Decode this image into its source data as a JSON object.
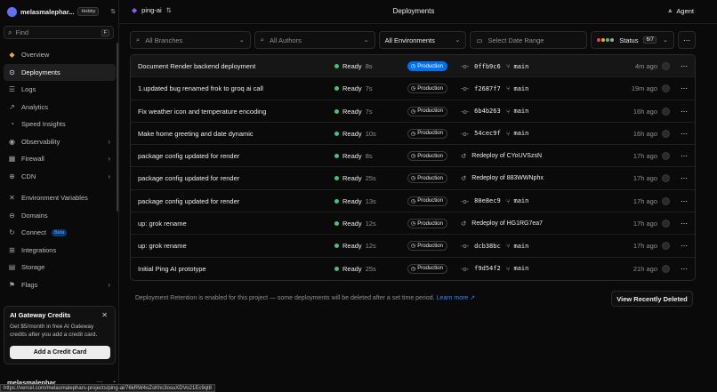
{
  "sidebar": {
    "team_name": "melasmalephar...",
    "plan_badge": "Hobby",
    "find_placeholder": "Find",
    "find_shortcut": "F",
    "items": [
      {
        "label": "Overview",
        "icon": "overview-icon"
      },
      {
        "label": "Deployments",
        "icon": "deployments-icon"
      },
      {
        "label": "Logs",
        "icon": "logs-icon"
      },
      {
        "label": "Analytics",
        "icon": "analytics-icon"
      },
      {
        "label": "Speed Insights",
        "icon": "speed-insights-icon"
      },
      {
        "label": "Observability",
        "icon": "observability-icon"
      },
      {
        "label": "Firewall",
        "icon": "firewall-icon"
      },
      {
        "label": "CDN",
        "icon": "cdn-icon"
      },
      {
        "label": "Environment Variables",
        "icon": "env-vars-icon"
      },
      {
        "label": "Domains",
        "icon": "domains-icon"
      },
      {
        "label": "Connect",
        "icon": "connect-icon",
        "badge": "Beta"
      },
      {
        "label": "Integrations",
        "icon": "integrations-icon"
      },
      {
        "label": "Storage",
        "icon": "storage-icon"
      },
      {
        "label": "Flags",
        "icon": "flags-icon"
      }
    ],
    "promo": {
      "title": "AI Gateway Credits",
      "text": "Get $5/month in free AI Gateway credits after you add a credit card.",
      "button": "Add a Credit Card"
    },
    "user_name": "melasmalephar"
  },
  "status_url": "https://vercel.com/melasmalephars-projects/ping-ai/76kRW4oZsKhc3osuXDVo21Ec9qt8",
  "topbar": {
    "project_name": "ping-ai",
    "title": "Deployments",
    "agent_label": "Agent"
  },
  "filters": {
    "branches_placeholder": "All Branches",
    "authors_placeholder": "All Authors",
    "environments_value": "All Environments",
    "date_placeholder": "Select Date Range",
    "status_label": "Status",
    "status_count": "6/7",
    "status_colors": [
      "#e5484d",
      "#f5a623",
      "#45c27a",
      "#a1a1a1"
    ]
  },
  "deployments": [
    {
      "title": "Document Render backend deployment",
      "status": "Ready",
      "duration": "8s",
      "env": "Production",
      "current": true,
      "commit": "0ffb9c6",
      "redeploy": false,
      "branch": "main",
      "time": "4m ago"
    },
    {
      "title": "1.updated bug renamed frok to groq ai call",
      "status": "Ready",
      "duration": "7s",
      "env": "Production",
      "current": false,
      "commit": "f2687f7",
      "redeploy": false,
      "branch": "main",
      "time": "19m ago"
    },
    {
      "title": "Fix weather icon and temperature encoding",
      "status": "Ready",
      "duration": "7s",
      "env": "Production",
      "current": false,
      "commit": "6b4b263",
      "redeploy": false,
      "branch": "main",
      "time": "16h ago"
    },
    {
      "title": "Make home greeting and date dynamic",
      "status": "Ready",
      "duration": "10s",
      "env": "Production",
      "current": false,
      "commit": "54cec9f",
      "redeploy": false,
      "branch": "main",
      "time": "16h ago"
    },
    {
      "title": "package config updated for render",
      "status": "Ready",
      "duration": "8s",
      "env": "Production",
      "current": false,
      "commit": "Redeploy of CYoUVSzsN",
      "redeploy": true,
      "branch": "",
      "time": "17h ago"
    },
    {
      "title": "package config updated for render",
      "status": "Ready",
      "duration": "25s",
      "env": "Production",
      "current": false,
      "commit": "Redeploy of 883WWNphx",
      "redeploy": true,
      "branch": "",
      "time": "17h ago"
    },
    {
      "title": "package config updated for render",
      "status": "Ready",
      "duration": "13s",
      "env": "Production",
      "current": false,
      "commit": "80e8ec9",
      "redeploy": false,
      "branch": "main",
      "time": "17h ago"
    },
    {
      "title": "up: grok rename",
      "status": "Ready",
      "duration": "12s",
      "env": "Production",
      "current": false,
      "commit": "Redeploy of HG1RG7ea7",
      "redeploy": true,
      "branch": "",
      "time": "17h ago"
    },
    {
      "title": "up: grok rename",
      "status": "Ready",
      "duration": "12s",
      "env": "Production",
      "current": false,
      "commit": "dcb38bc",
      "redeploy": false,
      "branch": "main",
      "time": "17h ago"
    },
    {
      "title": "Initial Ping AI prototype",
      "status": "Ready",
      "duration": "25s",
      "env": "Production",
      "current": false,
      "commit": "f9d54f2",
      "redeploy": false,
      "branch": "main",
      "time": "21h ago"
    }
  ],
  "retention": {
    "text": "Deployment Retention is enabled for this project — some deployments will be deleted after a set time period.",
    "link": "Learn more"
  },
  "view_deleted_button": "View Recently Deleted"
}
